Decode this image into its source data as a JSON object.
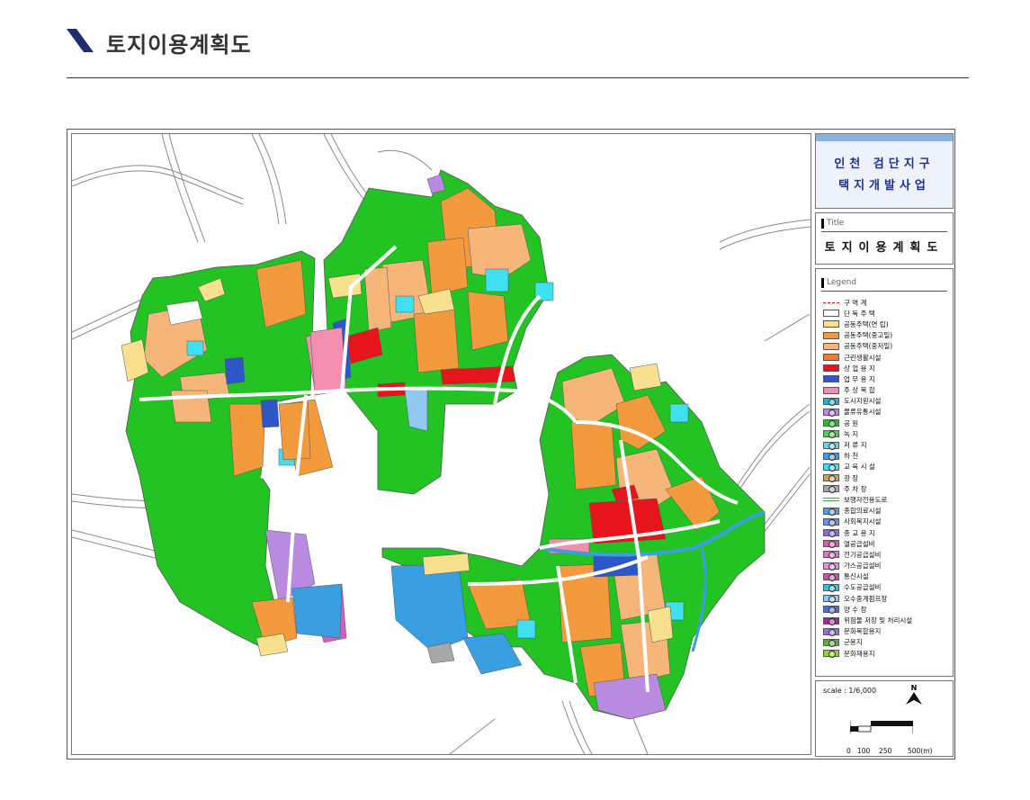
{
  "page": {
    "title": "토지이용계획도"
  },
  "project": {
    "line1": "인천 검단지구",
    "line2": "택지개발사업"
  },
  "title_box": {
    "label": "Title",
    "name": "토지이용계획도"
  },
  "legend": {
    "label": "Legend",
    "items": [
      {
        "label": "구 역 계",
        "color": "#ffffff",
        "style": "dash"
      },
      {
        "label": "단 독 주 택",
        "color": "#ffffff",
        "style": "box"
      },
      {
        "label": "공동주택(연 립)",
        "color": "#f9e08e",
        "style": "box"
      },
      {
        "label": "공동주택(중고밀)",
        "color": "#f39a3c",
        "style": "box"
      },
      {
        "label": "공동주택(중저밀)",
        "color": "#f7b679",
        "style": "box"
      },
      {
        "label": "근린생활시설",
        "color": "#f07a2a",
        "style": "box"
      },
      {
        "label": "상 업 용 지",
        "color": "#e8141c",
        "style": "box"
      },
      {
        "label": "업 무 용 지",
        "color": "#2d56c8",
        "style": "box"
      },
      {
        "label": "주 상 복 합",
        "color": "#f28fb0",
        "style": "box"
      },
      {
        "label": "도시지원시설",
        "color": "#25b2d9",
        "style": "circ"
      },
      {
        "label": "물류유통시설",
        "color": "#b98be0",
        "style": "circ"
      },
      {
        "label": "공 원",
        "color": "#22c322",
        "style": "circ"
      },
      {
        "label": "녹 지",
        "color": "#4fd14f",
        "style": "circ"
      },
      {
        "label": "저 류 지",
        "color": "#6fd4d4",
        "style": "circ"
      },
      {
        "label": "하 천",
        "color": "#3a9fe0",
        "style": "circ"
      },
      {
        "label": "교 육 시 설",
        "color": "#3fe0f0",
        "style": "circ"
      },
      {
        "label": "광 장",
        "color": "#c9a35a",
        "style": "circ"
      },
      {
        "label": "주 차 장",
        "color": "#a8a8a8",
        "style": "circ"
      },
      {
        "label": "보행자전용도로",
        "color": "#ffffff",
        "style": "walk"
      },
      {
        "label": "종합의료시설",
        "color": "#5aa0e0",
        "style": "circ"
      },
      {
        "label": "사회복지시설",
        "color": "#6c8fe8",
        "style": "circ"
      },
      {
        "label": "종 교 용 지",
        "color": "#8f6fe0",
        "style": "circ"
      },
      {
        "label": "열공급설비",
        "color": "#d85ca8",
        "style": "circ"
      },
      {
        "label": "전기공급설비",
        "color": "#d878c8",
        "style": "circ"
      },
      {
        "label": "가스공급설비",
        "color": "#e092d8",
        "style": "circ"
      },
      {
        "label": "통신시설",
        "color": "#c05aa8",
        "style": "circ"
      },
      {
        "label": "수도공급설비",
        "color": "#2fc8d8",
        "style": "circ"
      },
      {
        "label": "오수중계펌프장",
        "color": "#8fc8f0",
        "style": "circ"
      },
      {
        "label": "양 수 장",
        "color": "#4f6fd8",
        "style": "circ"
      },
      {
        "label": "위험물 저장 및 처리시설",
        "color": "#b01f8f",
        "style": "circ"
      },
      {
        "label": "문화복합용지",
        "color": "#9a70d8",
        "style": "circ"
      },
      {
        "label": "군용지",
        "color": "#5fae3a",
        "style": "circ"
      },
      {
        "label": "문화재용지",
        "color": "#8fd81f",
        "style": "circ"
      }
    ]
  },
  "scale": {
    "text": "scale : 1/6,000",
    "north": "N",
    "ticks": [
      "0",
      "100",
      "250",
      "500(m)"
    ]
  },
  "colors": {
    "green": "#22c322",
    "orange": "#f39a3c",
    "light_orange": "#f7b679",
    "yellow": "#f9e08e",
    "red": "#e8141c",
    "blue": "#2d56c8",
    "pink": "#f28fb0",
    "cyan": "#3fe0f0",
    "sky": "#3a9fe0",
    "purple": "#b98be0",
    "magenta": "#d060c0"
  }
}
